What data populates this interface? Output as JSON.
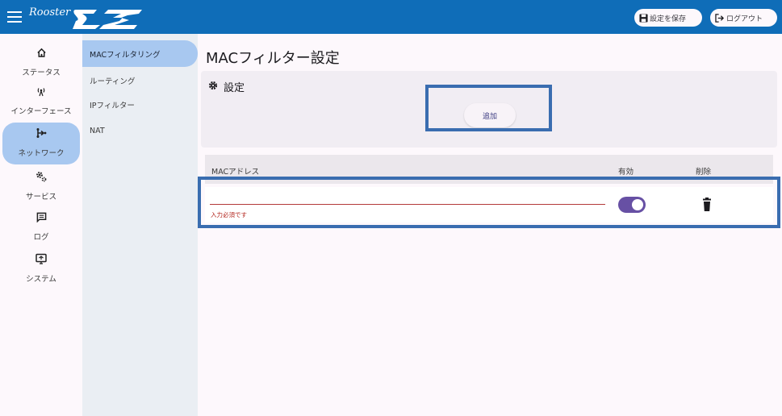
{
  "header": {
    "logo_text": "Rooster",
    "save_label": "設定を保存",
    "logout_label": "ログアウト",
    "bar_color": "#0f6db8"
  },
  "rail": {
    "items": [
      {
        "label": "ステータス",
        "icon": "home-icon"
      },
      {
        "label": "インターフェース",
        "icon": "antenna-icon"
      },
      {
        "label": "ネットワーク",
        "icon": "network-icon",
        "active": true
      },
      {
        "label": "サービス",
        "icon": "gears-icon"
      },
      {
        "label": "ログ",
        "icon": "log-icon"
      },
      {
        "label": "システム",
        "icon": "system-icon"
      }
    ]
  },
  "subnav": {
    "items": [
      {
        "label": "MACフィルタリング",
        "active": true
      },
      {
        "label": "ルーティング"
      },
      {
        "label": "IPフィルター"
      },
      {
        "label": "NAT"
      }
    ]
  },
  "main": {
    "title": "MACフィルター設定",
    "settings_heading": "設定",
    "add_label": "追加",
    "table": {
      "columns": [
        "MACアドレス",
        "有効",
        "削除"
      ],
      "rows": [
        {
          "mac": "",
          "error": "入力必須です",
          "enabled": true
        }
      ]
    }
  },
  "colors": {
    "accent": "#6750a4",
    "highlight": "#3a6db0",
    "nav_active": "#a8c8f0"
  }
}
